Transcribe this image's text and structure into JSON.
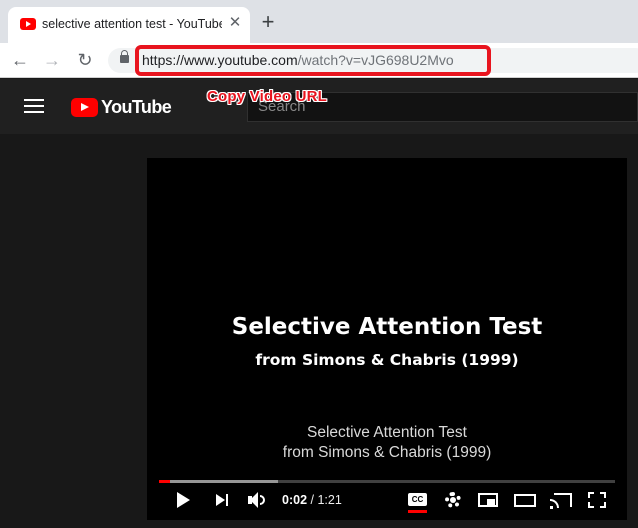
{
  "browser": {
    "tab": {
      "title": "selective attention test - YouTube",
      "close_glyph": "✕",
      "favicon": "youtube-favicon-icon"
    },
    "new_tab_glyph": "+",
    "nav": {
      "back_glyph": "←",
      "forward_glyph": "→",
      "reload_glyph": "↻"
    },
    "address_bar": {
      "url_host": "https://www.youtube.com",
      "url_path": "/watch?v=vJG698U2Mvo",
      "highlight_color": "#e8141e"
    }
  },
  "annotation": {
    "label": "Copy Video URL",
    "color": "#e8141e"
  },
  "youtube": {
    "logo_text": "YouTube",
    "search_placeholder": "Search",
    "brand_color": "#ff0000"
  },
  "player": {
    "video_title": "Selective Attention Test",
    "video_subtitle": "from Simons & Chabris (1999)",
    "captions": {
      "line1": "Selective Attention Test",
      "line2": "from Simons & Chabris (1999)"
    },
    "progress": {
      "played_fraction": 0.025,
      "buffered_fraction": 0.26
    },
    "time": {
      "current": "0:02",
      "separator": " / ",
      "duration": "1:21"
    },
    "cc_label": "CC",
    "controls": [
      "play-icon",
      "next-icon",
      "volume-icon",
      "cc-icon",
      "settings-icon",
      "miniplayer-icon",
      "theater-icon",
      "cast-icon",
      "fullscreen-icon"
    ]
  }
}
